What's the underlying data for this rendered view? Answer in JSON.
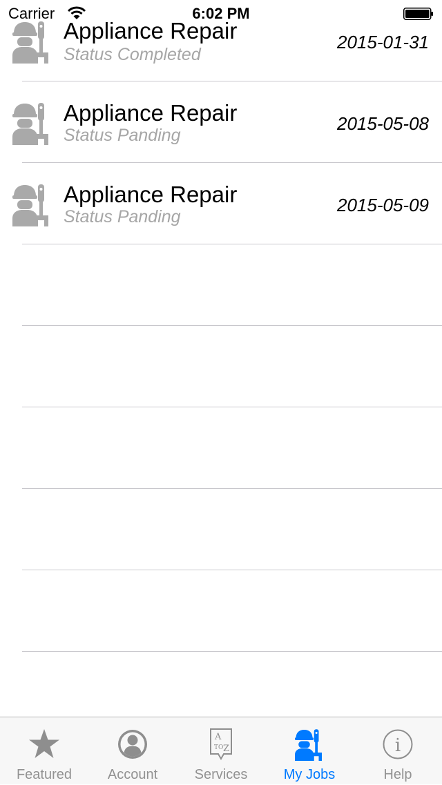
{
  "status_bar": {
    "carrier": "Carrier",
    "time": "6:02 PM"
  },
  "jobs": [
    {
      "title": "Appliance Repair",
      "status": "Status Completed",
      "date": "2015-01-31",
      "icon": "worker-wrench-icon"
    },
    {
      "title": "Appliance Repair",
      "status": "Status Panding",
      "date": "2015-05-08",
      "icon": "worker-wrench-icon"
    },
    {
      "title": "Appliance Repair",
      "status": "Status Panding",
      "date": "2015-05-09",
      "icon": "worker-wrench-icon"
    }
  ],
  "tab_bar": {
    "active": "My Jobs",
    "active_color": "#007aff",
    "inactive_color": "#929292",
    "tabs": [
      {
        "label": "Featured",
        "icon": "star-icon"
      },
      {
        "label": "Account",
        "icon": "user-icon"
      },
      {
        "label": "Services",
        "icon": "a-to-z-icon"
      },
      {
        "label": "My Jobs",
        "icon": "worker-wrench-icon"
      },
      {
        "label": "Help",
        "icon": "info-icon"
      }
    ]
  }
}
